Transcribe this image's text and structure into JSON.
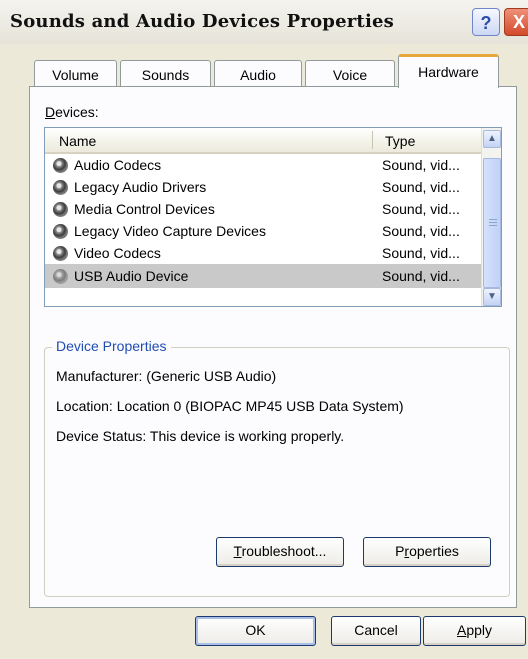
{
  "window": {
    "title": "Sounds and Audio Devices Properties",
    "help": "?",
    "close": "X"
  },
  "tabs": [
    "Volume",
    "Sounds",
    "Audio",
    "Voice",
    "Hardware"
  ],
  "active_tab": "Hardware",
  "devices": {
    "label": "Devices:",
    "columns": {
      "name": "Name",
      "type": "Type"
    },
    "rows": [
      {
        "name": "Audio Codecs",
        "type": "Sound, vid..."
      },
      {
        "name": "Legacy Audio Drivers",
        "type": "Sound, vid..."
      },
      {
        "name": "Media Control Devices",
        "type": "Sound, vid..."
      },
      {
        "name": "Legacy Video Capture Devices",
        "type": "Sound, vid..."
      },
      {
        "name": "Video Codecs",
        "type": "Sound, vid..."
      },
      {
        "name": "USB Audio Device",
        "type": "Sound, vid..."
      }
    ],
    "selected": "USB Audio Device"
  },
  "device_properties": {
    "label": "Device Properties",
    "manufacturer": "Manufacturer: (Generic USB Audio)",
    "location": "Location: Location 0 (BIOPAC MP45 USB Data System)",
    "status": "Device Status: This device is working properly."
  },
  "buttons": {
    "troubleshoot": "Troubleshoot...",
    "properties": "Properties",
    "ok": "OK",
    "cancel": "Cancel",
    "apply": "Apply"
  },
  "colors": {
    "group_label": "#1f4db3",
    "active_tab_accent": "#e6a83a",
    "selected_row": "#c9c9c9"
  }
}
